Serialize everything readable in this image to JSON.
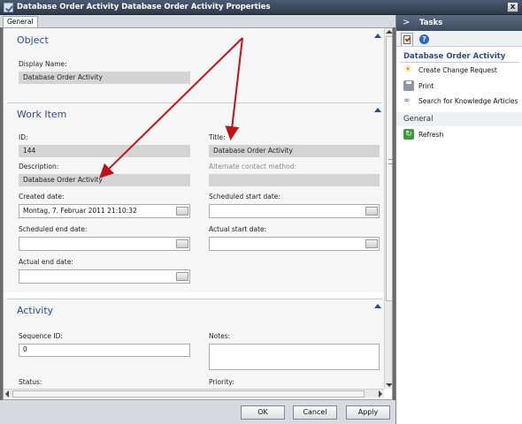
{
  "window": {
    "title": "Database Order Activity Database Order Activity Properties",
    "close_label": "x"
  },
  "tabs": [
    {
      "label": "General"
    }
  ],
  "object_section": {
    "title": "Object",
    "display_name_label": "Display Name:",
    "display_name_value": "Database Order Activity"
  },
  "work_item_section": {
    "title": "Work Item",
    "id_label": "ID:",
    "id_value": "144",
    "title_label": "Title:",
    "title_value": "Database Order Activity",
    "description_label": "Description:",
    "description_value": "Database Order Activity",
    "alt_contact_label": "Alternate contact method:",
    "alt_contact_value": "",
    "created_date_label": "Created date:",
    "created_date_value": "Montag, 7. Februar 2011 21:10:32",
    "scheduled_start_label": "Scheduled start date:",
    "scheduled_start_value": "",
    "scheduled_end_label": "Scheduled end date:",
    "scheduled_end_value": "",
    "actual_start_label": "Actual start date:",
    "actual_start_value": "",
    "actual_end_label": "Actual end date:",
    "actual_end_value": ""
  },
  "activity_section": {
    "title": "Activity",
    "sequence_id_label": "Sequence ID:",
    "sequence_id_value": "0",
    "notes_label": "Notes:",
    "status_label": "Status:",
    "priority_label": "Priority:"
  },
  "buttons": {
    "ok": "OK",
    "cancel": "Cancel",
    "apply": "Apply"
  },
  "tasks_pane": {
    "header": "Tasks",
    "chevron": ">",
    "help_glyph": "?",
    "group_title": "Database Order Activity",
    "items": [
      {
        "label": "Create Change Request",
        "icon": "sun-icon"
      },
      {
        "label": "Print",
        "icon": "printer-icon"
      },
      {
        "label": "Search for Knowledge Articles",
        "icon": "glasses-icon"
      }
    ],
    "general_title": "General",
    "general_items": [
      {
        "label": "Refresh",
        "icon": "refresh-icon"
      }
    ]
  },
  "colors": {
    "accent": "#2a4b9b",
    "annotation_arrow": "#c0121a",
    "titlebar": "#3e4b5f"
  }
}
